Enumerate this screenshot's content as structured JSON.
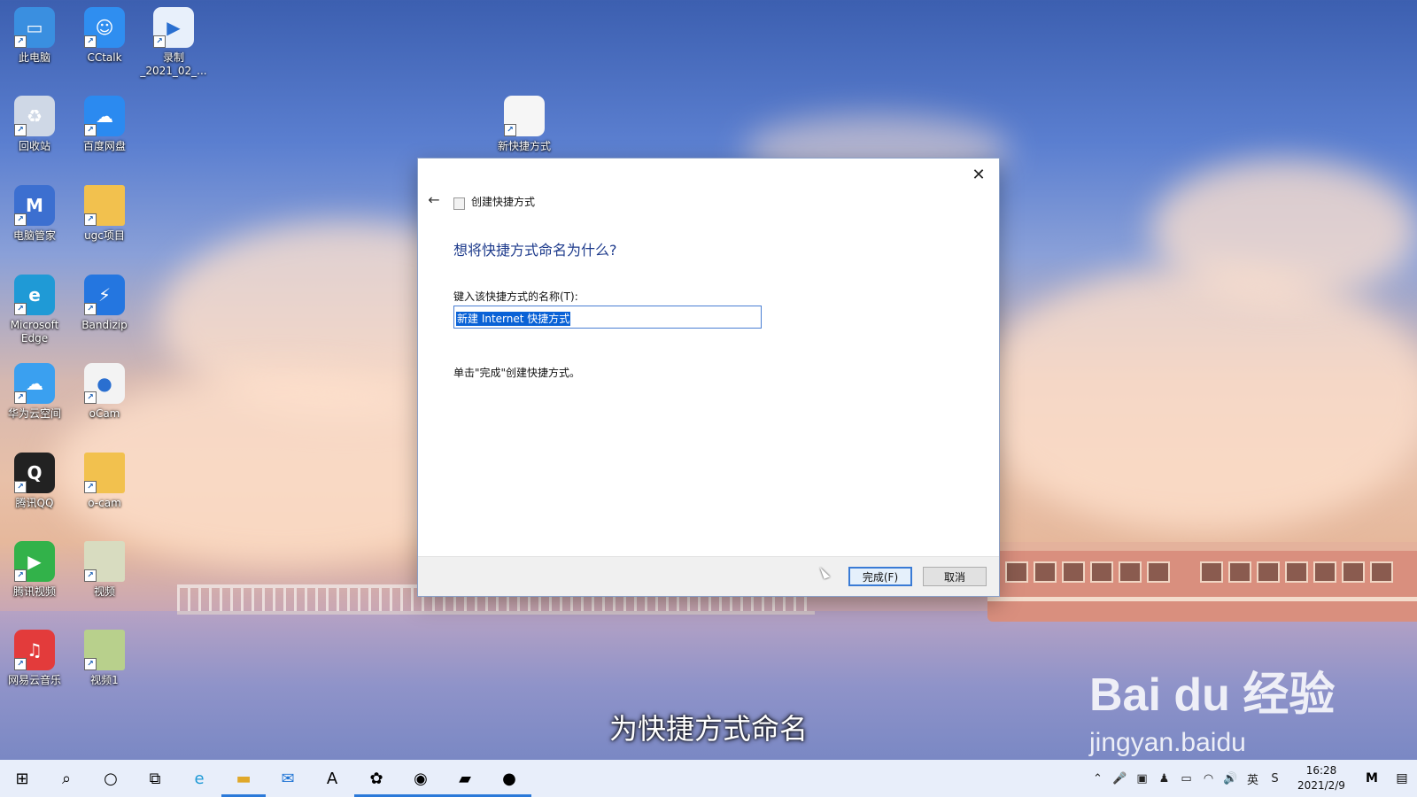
{
  "desktop_icons": [
    {
      "label": "此电脑",
      "icon": "this-pc-icon",
      "color": "#3a8fe0",
      "glyph": "▭"
    },
    {
      "label": "CCtalk",
      "icon": "cctalk-icon",
      "color": "#2f8ef0",
      "glyph": "☺"
    },
    {
      "label": "录制\n_2021_02_...",
      "icon": "recording-file-icon",
      "color": "#e8f0fb",
      "glyph": "▶"
    },
    {
      "label": "回收站",
      "icon": "recycle-bin-icon",
      "color": "#cfd8e6",
      "glyph": "♻"
    },
    {
      "label": "百度网盘",
      "icon": "baidu-netdisk-icon",
      "color": "#2b8af0",
      "glyph": "☁"
    },
    {
      "label": "新快捷方式",
      "icon": "new-shortcut-icon",
      "color": "#f6f6f6",
      "glyph": ""
    },
    {
      "label": "电脑管家",
      "icon": "pc-manager-icon",
      "color": "#3c6fd0",
      "glyph": "M"
    },
    {
      "label": "ugc项目",
      "icon": "folder-icon",
      "color": "#f2c14e",
      "glyph": ""
    },
    {
      "label": "Microsoft\nEdge",
      "icon": "edge-icon",
      "color": "#1f9ad6",
      "glyph": "e"
    },
    {
      "label": "Bandizip",
      "icon": "bandizip-icon",
      "color": "#2476e0",
      "glyph": "⚡"
    },
    {
      "label": "华为云空间",
      "icon": "huawei-cloud-icon",
      "color": "#3aa0f0",
      "glyph": "☁"
    },
    {
      "label": "oCam",
      "icon": "ocam-icon",
      "color": "#f3f3f3",
      "glyph": "●"
    },
    {
      "label": "腾讯QQ",
      "icon": "qq-icon",
      "color": "#222222",
      "glyph": "Q"
    },
    {
      "label": "o-cam",
      "icon": "folder-icon",
      "color": "#f2c14e",
      "glyph": ""
    },
    {
      "label": "腾讯视频",
      "icon": "tencent-video-icon",
      "color": "#32b24a",
      "glyph": "▶"
    },
    {
      "label": "视频",
      "icon": "video-folder-icon",
      "color": "#d8dcc0",
      "glyph": ""
    },
    {
      "label": "网易云音乐",
      "icon": "netease-music-icon",
      "color": "#e33b3b",
      "glyph": "♫"
    },
    {
      "label": "视频1",
      "icon": "video-folder-icon",
      "color": "#b8d08c",
      "glyph": ""
    }
  ],
  "dialog": {
    "title": "创建快捷方式",
    "heading": "想将快捷方式命名为什么?",
    "name_label": "键入该快捷方式的名称(T):",
    "name_value": "新建 Internet 快捷方式",
    "hint": "单击\"完成\"创建快捷方式。",
    "finish_label": "完成(F)",
    "cancel_label": "取消",
    "close_glyph": "✕",
    "back_glyph": "←"
  },
  "subtitle": "为快捷方式命名",
  "watermark": {
    "logo": "Bai du 经验",
    "url": "jingyan.baidu"
  },
  "taskbar": {
    "apps": [
      {
        "name": "start-icon",
        "glyph": "⊞",
        "active": false
      },
      {
        "name": "search-icon",
        "glyph": "⌕",
        "active": false
      },
      {
        "name": "cortana-icon",
        "glyph": "○",
        "active": false
      },
      {
        "name": "task-view-icon",
        "glyph": "⧉",
        "active": false
      },
      {
        "name": "edge-icon",
        "glyph": "e",
        "active": false
      },
      {
        "name": "file-explorer-icon",
        "glyph": "▬",
        "active": true
      },
      {
        "name": "mail-icon",
        "glyph": "✉",
        "active": false
      },
      {
        "name": "font-app-icon",
        "glyph": "A",
        "active": false
      },
      {
        "name": "photo-app-icon",
        "glyph": "✿",
        "active": true
      },
      {
        "name": "screen-recorder-icon",
        "glyph": "◉",
        "active": true
      },
      {
        "name": "notepad-icon",
        "glyph": "▰",
        "active": true
      },
      {
        "name": "ocam-icon",
        "glyph": "●",
        "active": true
      }
    ],
    "tray": [
      "⌃",
      "🎤",
      "▣",
      "♟",
      "▭",
      "◠",
      "🔊",
      "英",
      "S"
    ],
    "time": "16:28",
    "date": "2021/2/9",
    "pc_manager_glyph": "M",
    "notification_glyph": "▤"
  }
}
